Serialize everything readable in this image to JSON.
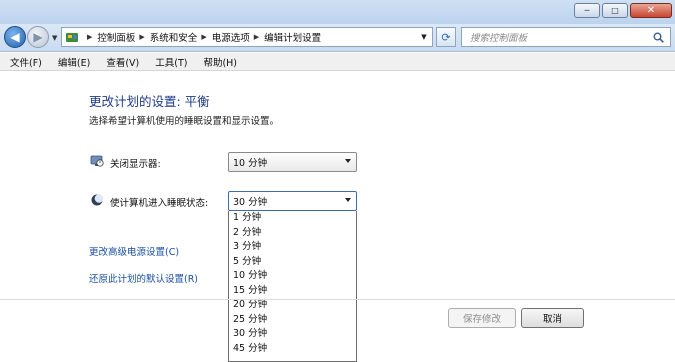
{
  "window": {
    "minimize_glyph": "─",
    "maximize_glyph": "□",
    "close_glyph": "✕"
  },
  "nav": {
    "back_glyph": "◀",
    "forward_glyph": "▶",
    "breadcrumbs": [
      "控制面板",
      "系统和安全",
      "电源选项",
      "编辑计划设置"
    ],
    "search_placeholder": "搜索控制面板",
    "icons": {
      "back": "back-arrow-icon",
      "forward": "forward-arrow-icon",
      "location": "control-panel-icon",
      "refresh": "refresh-icon",
      "search": "search-icon"
    }
  },
  "menu": {
    "items": [
      "文件(F)",
      "编辑(E)",
      "查看(V)",
      "工具(T)",
      "帮助(H)"
    ]
  },
  "page": {
    "title": "更改计划的设置: 平衡",
    "subtitle": "选择希望计算机使用的睡眠设置和显示设置。"
  },
  "settings": {
    "display_off": {
      "label": "关闭显示器:",
      "value": "10 分钟",
      "icon": "monitor-clock-icon"
    },
    "sleep": {
      "label": "使计算机进入睡眠状态:",
      "value": "30 分钟",
      "icon": "moon-sleep-icon",
      "options": [
        "1 分钟",
        "2 分钟",
        "3 分钟",
        "5 分钟",
        "10 分钟",
        "15 分钟",
        "20 分钟",
        "25 分钟",
        "30 分钟",
        "45 分钟"
      ]
    }
  },
  "links": {
    "advanced": "更改高级电源设置(C)",
    "restore": "还原此计划的默认设置(R)"
  },
  "buttons": {
    "save": "保存修改",
    "cancel": "取消"
  },
  "colors": {
    "title_blue": "#1e3a8a",
    "link_blue": "#1a4fa0",
    "chrome_blue": "#c9dbf0"
  }
}
